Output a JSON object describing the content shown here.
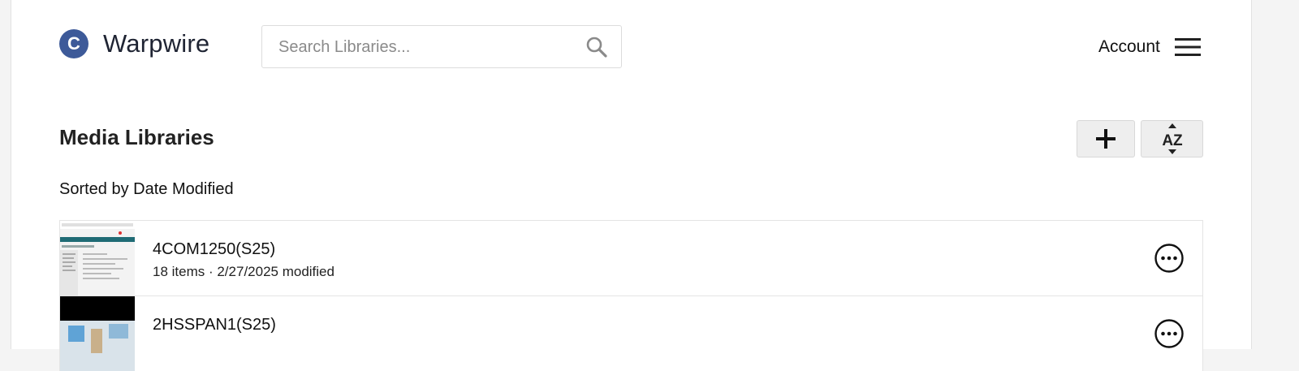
{
  "header": {
    "logo_letter": "C",
    "brand": "Warpwire",
    "search_placeholder": "Search Libraries...",
    "account_label": "Account"
  },
  "section": {
    "title": "Media Libraries",
    "sort_note": "Sorted by Date Modified",
    "sort_button_text": "AZ"
  },
  "libraries": [
    {
      "name": "4COM1250(S25)",
      "meta": "18 items · 2/27/2025 modified"
    },
    {
      "name": "2HSSPAN1(S25)",
      "meta": ""
    }
  ],
  "colors": {
    "brand": "#3d5a99",
    "button_bg": "#eeeeee"
  }
}
